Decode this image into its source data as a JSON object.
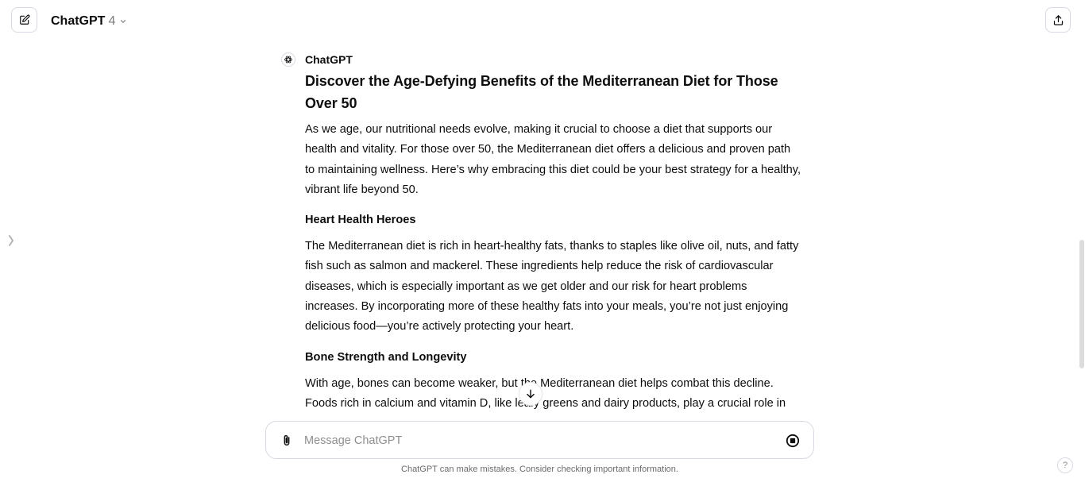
{
  "header": {
    "model_name": "ChatGPT",
    "model_version": "4",
    "icons": {
      "new_chat": "new-chat-icon",
      "model_dropdown": "chevron-down-icon",
      "share": "share-icon"
    }
  },
  "message": {
    "author": "ChatGPT",
    "avatar_icon": "openai-logo-icon",
    "title": "Discover the Age-Defying Benefits of the Mediterranean Diet for Those Over 50",
    "intro": "As we age, our nutritional needs evolve, making it crucial to choose a diet that supports our health and vitality. For those over 50, the Mediterranean diet offers a delicious and proven path to maintaining wellness. Here’s why embracing this diet could be your best strategy for a healthy, vibrant life beyond 50.",
    "sections": [
      {
        "heading": "Heart Health Heroes",
        "body": "The Mediterranean diet is rich in heart-healthy fats, thanks to staples like olive oil, nuts, and fatty fish such as salmon and mackerel. These ingredients help reduce the risk of cardiovascular diseases, which is especially important as we get older and our risk for heart problems increases. By incorporating more of these healthy fats into your meals, you’re not just enjoying delicious food—you’re actively protecting your heart."
      },
      {
        "heading": "Bone Strength and Longevity",
        "body": "With age, bones can become weaker, but the Mediterranean diet helps combat this decline. Foods rich in calcium and vitamin D, like leafy greens and dairy products, play a crucial role in bone"
      }
    ]
  },
  "composer": {
    "placeholder": "Message ChatGPT",
    "value": "",
    "icons": {
      "attach": "paperclip-icon",
      "stop": "stop-icon"
    }
  },
  "disclaimer": "ChatGPT can make mistakes. Consider checking important information.",
  "help_label": "?",
  "icons": {
    "sidebar_toggle": "sidebar-toggle-icon",
    "scroll_down": "arrow-down-icon"
  }
}
